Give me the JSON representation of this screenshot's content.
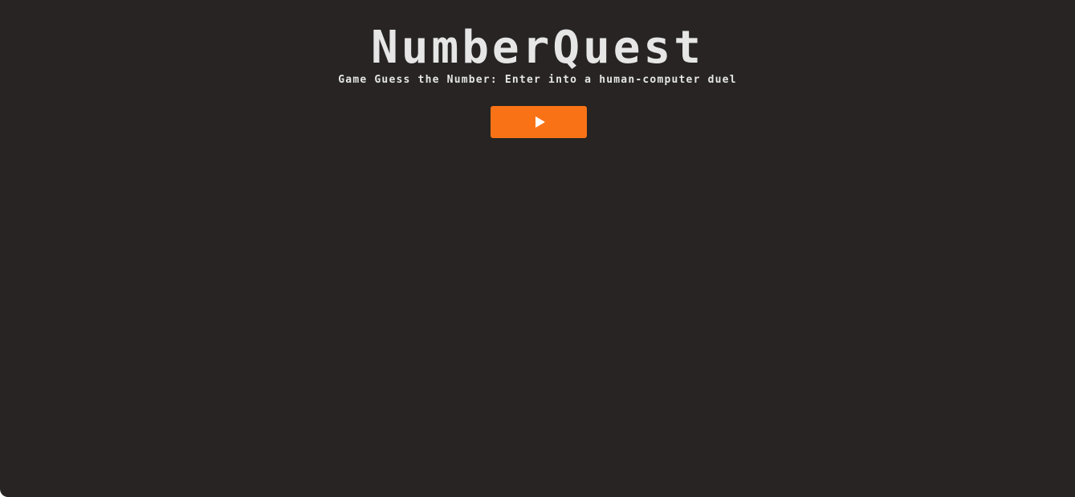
{
  "game": {
    "title": "NumberQuest",
    "subtitle": "Game Guess the Number: Enter into a human-computer duel"
  },
  "play_button": {
    "icon": "play-icon",
    "color": "#f97316"
  },
  "theme": {
    "background": "#272423",
    "text": "#e6e6e6"
  }
}
